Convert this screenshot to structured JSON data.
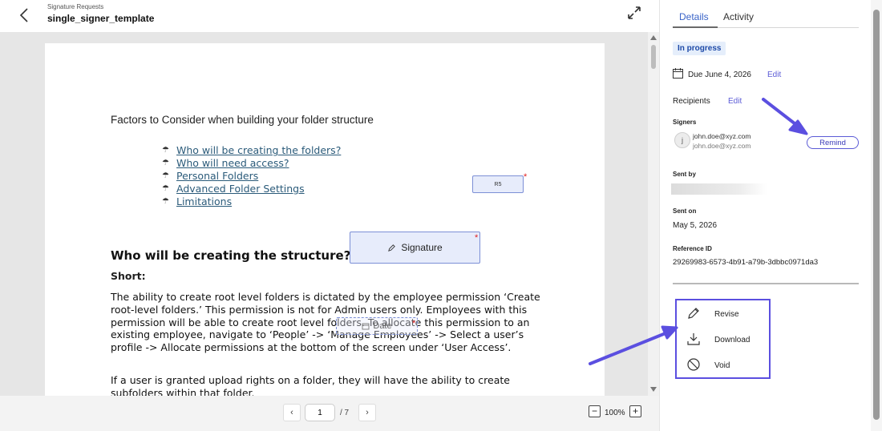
{
  "header": {
    "breadcrumb": "Signature Requests",
    "title": "single_signer_template"
  },
  "document": {
    "heading": "Factors to Consider when building your folder structure",
    "toc": [
      "Who will be creating the folders?",
      "Who will need access?",
      "Personal Folders",
      "Advanced Folder Settings",
      "Limitations"
    ],
    "section_title": "Who will be creating the structure?",
    "short_label": "Short:",
    "paragraph1": "The ability to create root level folders is dictated by the employee permission ‘Create root-level folders.’ This permission is not for Admin users only. Employees with this permission will be able to create root level folders. To allocate this permission to an existing employee, navigate to ‘People’ -> ‘Manage Employees’ -> Select a user’s profile -> Allocate permissions at the bottom of the screen under ‘User Access’.",
    "paragraph2": "If a user is granted upload rights on a folder, they will have the ability to create subfolders within that folder.",
    "fields": {
      "initials": "R5",
      "signature": "Signature",
      "date": "Date",
      "required_mark": "*"
    }
  },
  "pagination": {
    "current_page": "1",
    "total": "/ 7",
    "prev": "‹",
    "next": "›"
  },
  "zoom": {
    "value": "100%",
    "minus": "−",
    "plus": "+"
  },
  "panel": {
    "tabs": [
      "Details",
      "Activity"
    ],
    "active_tab": "Details",
    "status": "In progress",
    "due": "Due June 4, 2026",
    "edit_label": "Edit",
    "recipients_label": "Recipients",
    "signers_label": "Signers",
    "signer": {
      "initial": "j",
      "email": "john.doe@xyz.com",
      "email_secondary": "john.doe@xyz.com"
    },
    "remind_label": "Remind",
    "sent_by_label": "Sent by",
    "sent_on_label": "Sent on",
    "sent_on": "May 5, 2026",
    "reference_label": "Reference ID",
    "reference_id": "29269983-6573-4b91-a79b-3dbbc0971da3",
    "actions": [
      "Revise",
      "Download",
      "Void"
    ]
  },
  "colors": {
    "accent": "#5b5bd6",
    "highlight_box": "#5b4fe0",
    "status_bg": "#e5eefb",
    "status_text": "#1e4aa8",
    "link": "#2b5b7a"
  }
}
